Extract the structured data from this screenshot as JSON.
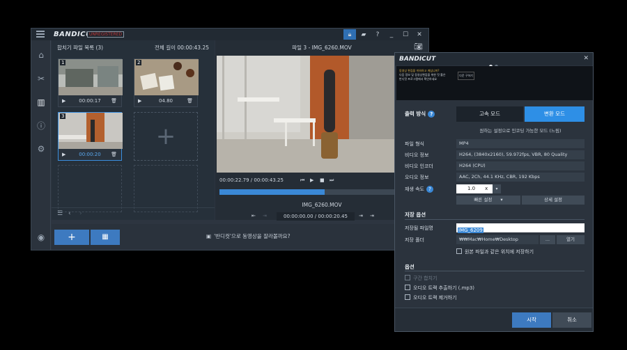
{
  "main": {
    "logo": "BANDICUT",
    "unregistered": "UNREGISTERED",
    "list_title": "합치기 파일 목록 (3)",
    "total_length": "전체 길이 00:00:43.25",
    "clips": [
      {
        "num": "1",
        "time": "00:00:17"
      },
      {
        "num": "2",
        "time": "04.80"
      },
      {
        "num": "3",
        "time": "00:00:20"
      }
    ],
    "preview_title": "파일 3 - IMG_6260.MOV",
    "player_time": "00:00:22.79 / 00:00:43.25",
    "clip_name": "IMG_6260.MOV",
    "range_time": "00:00:00.00 / 00:00:20.45",
    "hint": "'반디컷'으로 동영상을 잘라볼까요?",
    "add_label": "+",
    "timeline_progress": 0.51,
    "icons": [
      "hamburger-icon",
      "home-icon",
      "cut-icon",
      "join-icon",
      "info-icon",
      "gear-icon",
      "record-icon",
      "lock-icon",
      "folder-icon",
      "help-icon",
      "minimize-icon",
      "maximize-icon",
      "close-icon",
      "camera-icon",
      "play-icon",
      "trash-icon"
    ]
  },
  "dialog": {
    "logo": "BANDICUT",
    "banner": {
      "line1": "동영상 편집을 쉬워하고 계십니까?",
      "line2": "다음 정보 및 동영상편집을 위한 컷 툴은",
      "line3": "반디컷 프로그램에서 확인하세요",
      "btn": "다운 구하기"
    },
    "output_label": "출력 방식",
    "mode_fast": "고속 모드",
    "mode_encode": "변환 모드",
    "mode_desc": "원하는 설정으로 인코딩 가능한 모드 (느림)",
    "rows": [
      {
        "label": "파일 형식",
        "value": "MP4"
      },
      {
        "label": "비디오 정보",
        "value": "H264, (3840x2160), 59.972fps, VBR, 80 Quality"
      },
      {
        "label": "비디오 인코더",
        "value": "H264 (CPU)"
      },
      {
        "label": "오디오 정보",
        "value": "AAC, 2Ch, 44.1 KHz, CBR, 192 Kbps"
      }
    ],
    "speed_label": "재생 속도",
    "speed_value": "1.0",
    "speed_unit": "x",
    "quick_setting": "빠른 설정",
    "detail_setting": "상세 설정",
    "save_section": "저장 옵션",
    "save_name_label": "저장될 파일명",
    "save_name_value": "IMG_6209",
    "save_folder_label": "저장 폴더",
    "save_folder_value": "₩₩Mac₩Home₩Desktop",
    "browse": "...",
    "open": "열기",
    "same_location": "원본 파일과 같은 위치에 저장하기",
    "options_section": "옵션",
    "opt_segment": "구간 합치기",
    "opt_extract_audio": "오디오 트랙 추출하기 (.mp3)",
    "opt_remove_audio": "오디오 트랙 제거하기",
    "start": "시작",
    "cancel": "취소",
    "close_glyph": "✕"
  }
}
